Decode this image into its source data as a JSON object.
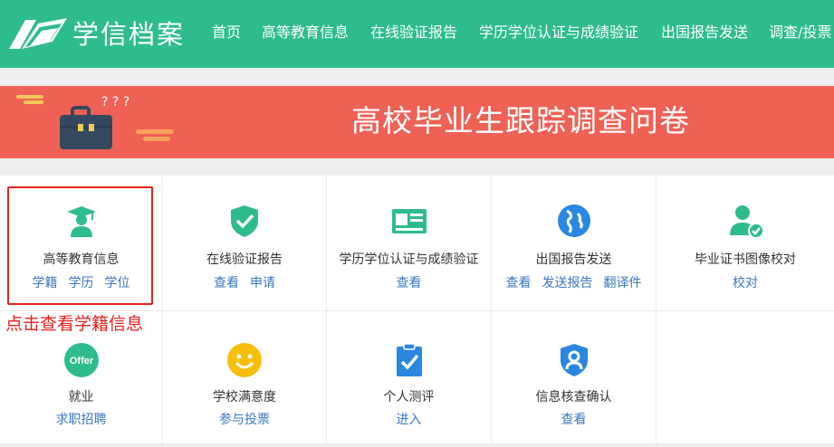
{
  "header": {
    "brand": "学信档案",
    "nav": [
      "首页",
      "高等教育信息",
      "在线验证报告",
      "学历学位认证与成绩验证",
      "出国报告发送",
      "调查/投票"
    ]
  },
  "banner": {
    "title": "高校毕业生跟踪调查问卷",
    "art_marks": "? ? ?"
  },
  "colors": {
    "nav_bg": "#2ebc8c",
    "banner_bg": "#ef6155",
    "link": "#3a78c2",
    "annotation": "#e8201b"
  },
  "services": [
    {
      "label": "高等教育信息",
      "icon": "graduate-icon",
      "links": [
        "学籍",
        "学历",
        "学位"
      ]
    },
    {
      "label": "在线验证报告",
      "icon": "shield-check-icon",
      "links": [
        "查看",
        "申请"
      ]
    },
    {
      "label": "学历学位认证与成绩验证",
      "icon": "id-card-icon",
      "links": [
        "查看"
      ]
    },
    {
      "label": "出国报告发送",
      "icon": "globe-icon",
      "links": [
        "查看",
        "发送报告",
        "翻译件"
      ]
    },
    {
      "label": "毕业证书图像校对",
      "icon": "user-check-icon",
      "links": [
        "校对"
      ]
    },
    {
      "label": "就业",
      "icon": "offer-icon",
      "icon_text": "Offer",
      "links": [
        "求职招聘"
      ]
    },
    {
      "label": "学校满意度",
      "icon": "smiley-icon",
      "links": [
        "参与投票"
      ]
    },
    {
      "label": "个人测评",
      "icon": "clipboard-check-icon",
      "links": [
        "进入"
      ]
    },
    {
      "label": "信息核查确认",
      "icon": "shield-user-icon",
      "links": [
        "查看"
      ]
    }
  ],
  "annotation": "点击查看学籍信息"
}
